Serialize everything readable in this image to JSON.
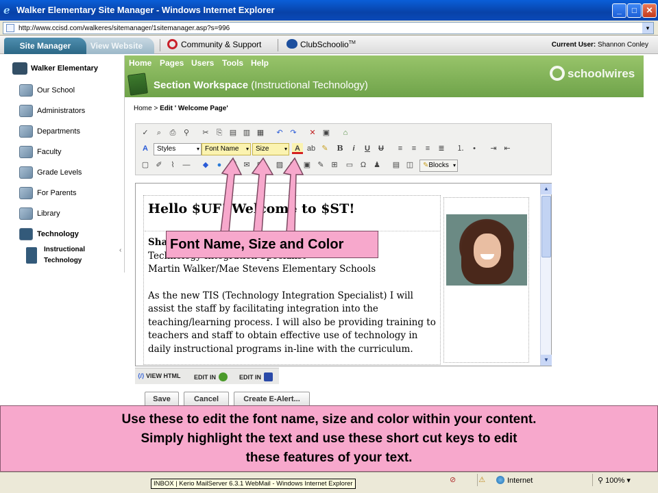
{
  "window": {
    "title": "Walker Elementary Site Manager - Windows Internet Explorer",
    "controls": {
      "minimize": "_",
      "maximize": "□",
      "close": "✕"
    }
  },
  "address": {
    "url": "http://www.ccisd.com/walkeres/sitemanager/1sitemanager.asp?s=996",
    "dropdown": "▾"
  },
  "topnav": {
    "tab_site_manager": "Site Manager",
    "tab_view_website": "View Website",
    "community": "Community & Support",
    "clubschoolio": "ClubSchoolio",
    "clubschoolio_tm": "TM",
    "current_user_label": "Current User:",
    "current_user_name": "Shannon Conley"
  },
  "sidebar": {
    "root": "Walker Elementary",
    "items": [
      {
        "label": "Our School"
      },
      {
        "label": "Administrators"
      },
      {
        "label": "Departments"
      },
      {
        "label": "Faculty"
      },
      {
        "label": "Grade Levels"
      },
      {
        "label": "For Parents"
      },
      {
        "label": "Library"
      },
      {
        "label": "Technology"
      }
    ],
    "sub_item": "Instructional Technology",
    "collapse": "‹"
  },
  "header": {
    "menu": [
      "Home",
      "Pages",
      "Users",
      "Tools",
      "Help"
    ],
    "section_title": "Section Workspace",
    "section_sub": "(Instructional Technology)",
    "logo": "schoolwires"
  },
  "breadcrumb": {
    "home": "Home",
    "sep": ">",
    "current": "Edit ' Welcome Page'"
  },
  "toolbar": {
    "styles": "Styles",
    "font_name": "Font Name",
    "size": "Size",
    "blocks": "Blocks",
    "dropdown_arrow": "▾"
  },
  "content": {
    "heading": "Hello $UF! Welcome to $ST!",
    "name": "Shannon Conley",
    "title_line": "Technology Integration Specialist",
    "school_line": "Martin Walker/Mae Stevens Elementary Schools",
    "paragraph": "As the new TIS (Technology Integration Specialist) I will assist the staff by facilitating integration into the teaching/learning process. I will also be providing training to teachers and staff to obtain effective use of technology in daily instructional programs in-line with the curriculum."
  },
  "modebar": {
    "view_html": "VIEW HTML",
    "edit_in_1": "EDIT IN",
    "edit_in_2": "EDIT IN"
  },
  "buttons": {
    "save": "Save",
    "cancel": "Cancel",
    "create_alert": "Create E-Alert..."
  },
  "callout": {
    "font_label": "Font Name, Size and Color"
  },
  "banner": {
    "line1": "Use these to edit the font name, size and color within your content.",
    "line2": "Simply highlight the text and use these short cut keys to edit",
    "line3": "these features of your text."
  },
  "statusbar": {
    "tooltip": "INBOX | Kerio MailServer 6.3.1 WebMail - Windows Internet Explorer",
    "zone": "Internet",
    "zoom": "100%"
  },
  "colors": {
    "accent_green": "#7fb052",
    "callout_pink": "#f7a8cc",
    "title_blue": "#0a49b8"
  }
}
